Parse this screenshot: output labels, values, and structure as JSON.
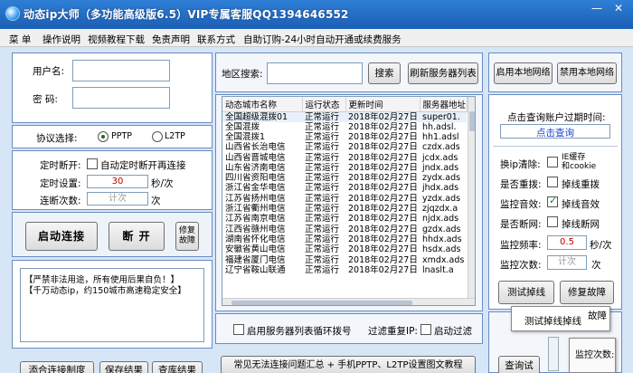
{
  "window": {
    "title": "动态ip大师（多功能高级版6.5）VIP专属客服QQ1394646552",
    "minimize_glyph": "—",
    "close_glyph": "✕"
  },
  "menu": [
    "菜 单",
    "操作说明",
    "视频教程下载",
    "免责声明",
    "联系方式",
    "自助订购-24小时自动开通或续费服务"
  ],
  "login": {
    "username_label": "用户名:",
    "username_value": "",
    "password_label": "密  码:",
    "password_value": ""
  },
  "protocol": {
    "label": "协议选择:",
    "options": [
      "PPTP",
      "L2TP"
    ],
    "selected": "PPTP"
  },
  "timer": {
    "timed_disconnect_label": "定时断开:",
    "auto_reconnect_label": "自动定时断开再连接",
    "auto_reconnect_checked": false,
    "interval_label": "定时设置:",
    "interval_value": "30",
    "interval_unit": "秒/次",
    "count_label": "连断次数:",
    "count_placeholder": "计次",
    "count_unit": "次"
  },
  "actions": {
    "start_connect": "启动连接",
    "disconnect": "断 开",
    "repair_line1": "修复",
    "repair_line2": "故障"
  },
  "log": {
    "lines": [
      "【严禁非法用途，所有使用后果自负！】",
      "【千万动态ip，约150城市高速稳定安全】"
    ]
  },
  "bottom_left_buttons": [
    "添合连接制度",
    "保存结果",
    "查库结果"
  ],
  "search": {
    "label": "地区搜索:",
    "value": "",
    "search_button": "搜索",
    "refresh_button": "刷新服务器列表"
  },
  "server_table": {
    "columns": [
      "动态城市名称",
      "运行状态",
      "更新时间",
      "服务器地址"
    ],
    "rows": [
      [
        "全国超级混拨01",
        "正常运行",
        "2018年02月27日",
        "super01."
      ],
      [
        "全国混拨",
        "正常运行",
        "2018年02月27日",
        "hh.adsl."
      ],
      [
        "全国混拨1",
        "正常运行",
        "2018年02月27日",
        "hh1.adsl"
      ],
      [
        "山西省长治电信",
        "正常运行",
        "2018年02月27日",
        "czdx.ads"
      ],
      [
        "山西省晋城电信",
        "正常运行",
        "2018年02月27日",
        "jcdx.ads"
      ],
      [
        "山东省济南电信",
        "正常运行",
        "2018年02月27日",
        "jndx.ads"
      ],
      [
        "四川省资阳电信",
        "正常运行",
        "2018年02月27日",
        "zydx.ads"
      ],
      [
        "浙江省金华电信",
        "正常运行",
        "2018年02月27日",
        "jhdx.ads"
      ],
      [
        "江苏省扬州电信",
        "正常运行",
        "2018年02月27日",
        "yzdx.ads"
      ],
      [
        "浙江省衢州电信",
        "正常运行",
        "2018年02月27日",
        "zjqzdx.a"
      ],
      [
        "江苏省南京电信",
        "正常运行",
        "2018年02月27日",
        "njdx.ads"
      ],
      [
        "江西省赣州电信",
        "正常运行",
        "2018年02月27日",
        "gzdx.ads"
      ],
      [
        "湖南省怀化电信",
        "正常运行",
        "2018年02月27日",
        "hhdx.ads"
      ],
      [
        "安徽省黄山电信",
        "正常运行",
        "2018年02月27日",
        "hsdx.ads"
      ],
      [
        "福建省厦门电信",
        "正常运行",
        "2018年02月27日",
        "xmdx.ads"
      ],
      [
        "辽宁省鞍山联通",
        "正常运行",
        "2018年02月27日",
        "lnaslt.a"
      ]
    ]
  },
  "loop_dial": {
    "label": "启用服务器列表循环拨号",
    "checked": false
  },
  "filter": {
    "label": "过滤重复IP:",
    "auto_filter_label": "启动过滤",
    "checked": false
  },
  "faq_button": "常见无法连接问题汇总 + 手机PPTP、L2TP设置图文教程",
  "local_network": {
    "enable": "启用本地网络",
    "disable": "禁用本地网络"
  },
  "expiry": {
    "label": "点击查询账户过期时间:",
    "link": "点击查询"
  },
  "options": {
    "clear_ip_label": "换ip清除:",
    "clear_ip_option_line1": "IE缓存",
    "clear_ip_option_line2": "和cookie",
    "clear_ip_checked": false,
    "redial_label": "是否重拨:",
    "redial_option": "掉线重拨",
    "redial_checked": false,
    "sound_label": "监控音效:",
    "sound_option": "掉线音效",
    "sound_checked": true,
    "disconnect_label": "是否断网:",
    "disconnect_option": "掉线断网",
    "disconnect_checked": false,
    "freq_label": "监控频率:",
    "freq_value": "0.5",
    "freq_unit": "秒/次",
    "count_label": "监控次数:",
    "count_placeholder": "计次",
    "count_unit": "次"
  },
  "right_buttons": {
    "test_drop": "测试掉线",
    "repair": "修复故障",
    "query_exp": "查询试"
  },
  "overlay": {
    "popup_label": "测试掉线掉线",
    "popup_tail": "故障",
    "small_label": "监控次数:"
  }
}
